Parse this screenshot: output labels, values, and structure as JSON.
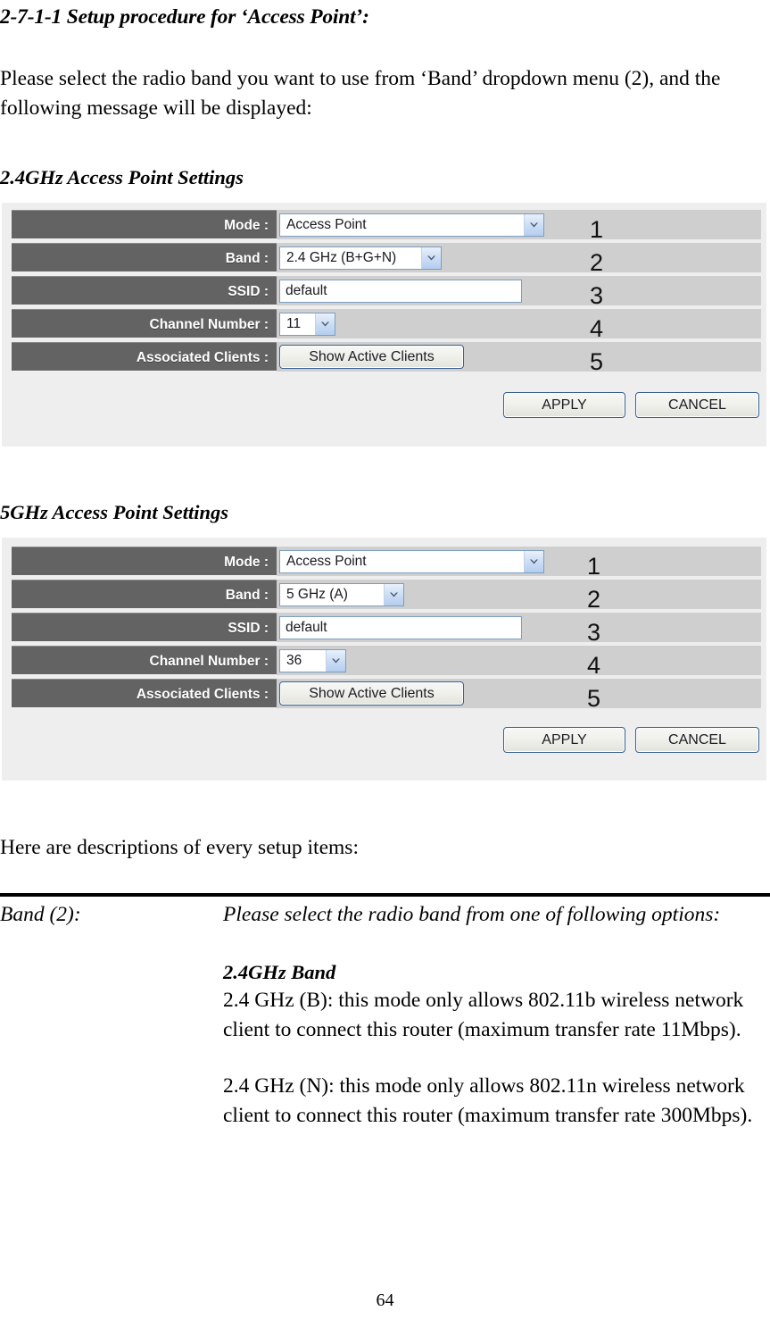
{
  "document": {
    "title": "2-7-1-1 Setup procedure for ‘Access Point’:",
    "intro_paragraph": "Please select the radio band you want to use from ‘Band’ dropdown menu (2), and the following message will be displayed:",
    "section_24_title": "2.4GHz Access Point Settings",
    "section_5_title": "5GHz Access Point Settings",
    "descriptions_intro": "Here are descriptions of every setup items:",
    "page_number": "64"
  },
  "panel_24ghz": {
    "rows": [
      {
        "label": "Mode :",
        "control": "select",
        "value": "Access Point",
        "number": "1"
      },
      {
        "label": "Band :",
        "control": "select",
        "value": "2.4 GHz (B+G+N)",
        "number": "2"
      },
      {
        "label": "SSID :",
        "control": "textinput",
        "value": "default",
        "number": "3"
      },
      {
        "label": "Channel Number :",
        "control": "select",
        "value": "11",
        "number": "4"
      },
      {
        "label": "Associated Clients :",
        "control": "button",
        "value": "Show Active Clients",
        "number": "5"
      }
    ],
    "apply_label": "APPLY",
    "cancel_label": "CANCEL"
  },
  "panel_5ghz": {
    "rows": [
      {
        "label": "Mode :",
        "control": "select",
        "value": "Access Point",
        "number": "1"
      },
      {
        "label": "Band :",
        "control": "select",
        "value": "5 GHz (A)",
        "number": "2"
      },
      {
        "label": "SSID :",
        "control": "textinput",
        "value": "default",
        "number": "3"
      },
      {
        "label": "Channel Number :",
        "control": "select",
        "value": "36",
        "number": "4"
      },
      {
        "label": "Associated Clients :",
        "control": "button",
        "value": "Show Active Clients",
        "number": "5"
      }
    ],
    "apply_label": "APPLY",
    "cancel_label": "CANCEL"
  },
  "definition": {
    "term": "Band (2):",
    "lead": "Please select the radio band from one of following options:",
    "subheading": "2.4GHz Band",
    "para_b": "2.4 GHz (B): this mode only allows 802.11b wireless network client to connect this router (maximum transfer rate 11Mbps).",
    "para_n": "2.4 GHz (N): this mode only allows 802.11n wireless network client to connect this router (maximum transfer rate 300Mbps)."
  },
  "colors": {
    "panel_background": "#eeeeee",
    "row_background": "#cfcfcf",
    "label_background": "#636363",
    "label_text": "#ffffff",
    "control_border": "#7b9ec1",
    "button_border": "#37618f"
  }
}
